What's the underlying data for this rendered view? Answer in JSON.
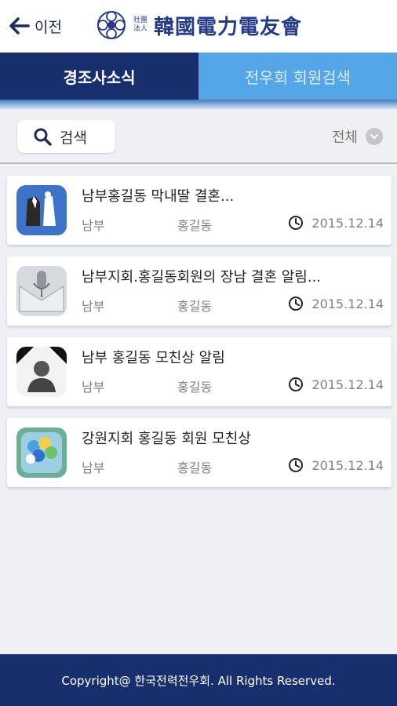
{
  "header": {
    "back_label": "이전",
    "logo_small": "社團 法人",
    "logo_text": "韓國電力電友會"
  },
  "tabs": [
    {
      "label": "경조사소식",
      "active": true
    },
    {
      "label": "전우회 회원검색",
      "active": false
    }
  ],
  "search": {
    "button_label": "검색",
    "filter_value": "전체"
  },
  "items": [
    {
      "title": "남부홍길동 막내딸 결혼...",
      "region": "남부",
      "author": "홍길동",
      "date": "2015.12.14",
      "icon": "wedding-couple-icon"
    },
    {
      "title": "남부지회.홍길동회원의 장남 결혼 알림...",
      "region": "남부",
      "author": "홍길동",
      "date": "2015.12.14",
      "icon": "microphone-envelope-icon"
    },
    {
      "title": "남부 홍길동 모친상 알림",
      "region": "남부",
      "author": "홍길동",
      "date": "2015.12.14",
      "icon": "mourning-portrait-icon"
    },
    {
      "title": "강원지회 홍길동 회원 모친상",
      "region": "남부",
      "author": "홍길동",
      "date": "2015.12.14",
      "icon": "balloons-icon"
    }
  ],
  "footer": {
    "copyright": "Copyright@ 한국전력전우회. All Rights Reserved."
  },
  "colors": {
    "navy": "#17306d",
    "sky": "#55a6e7",
    "background": "#eef0f3"
  }
}
